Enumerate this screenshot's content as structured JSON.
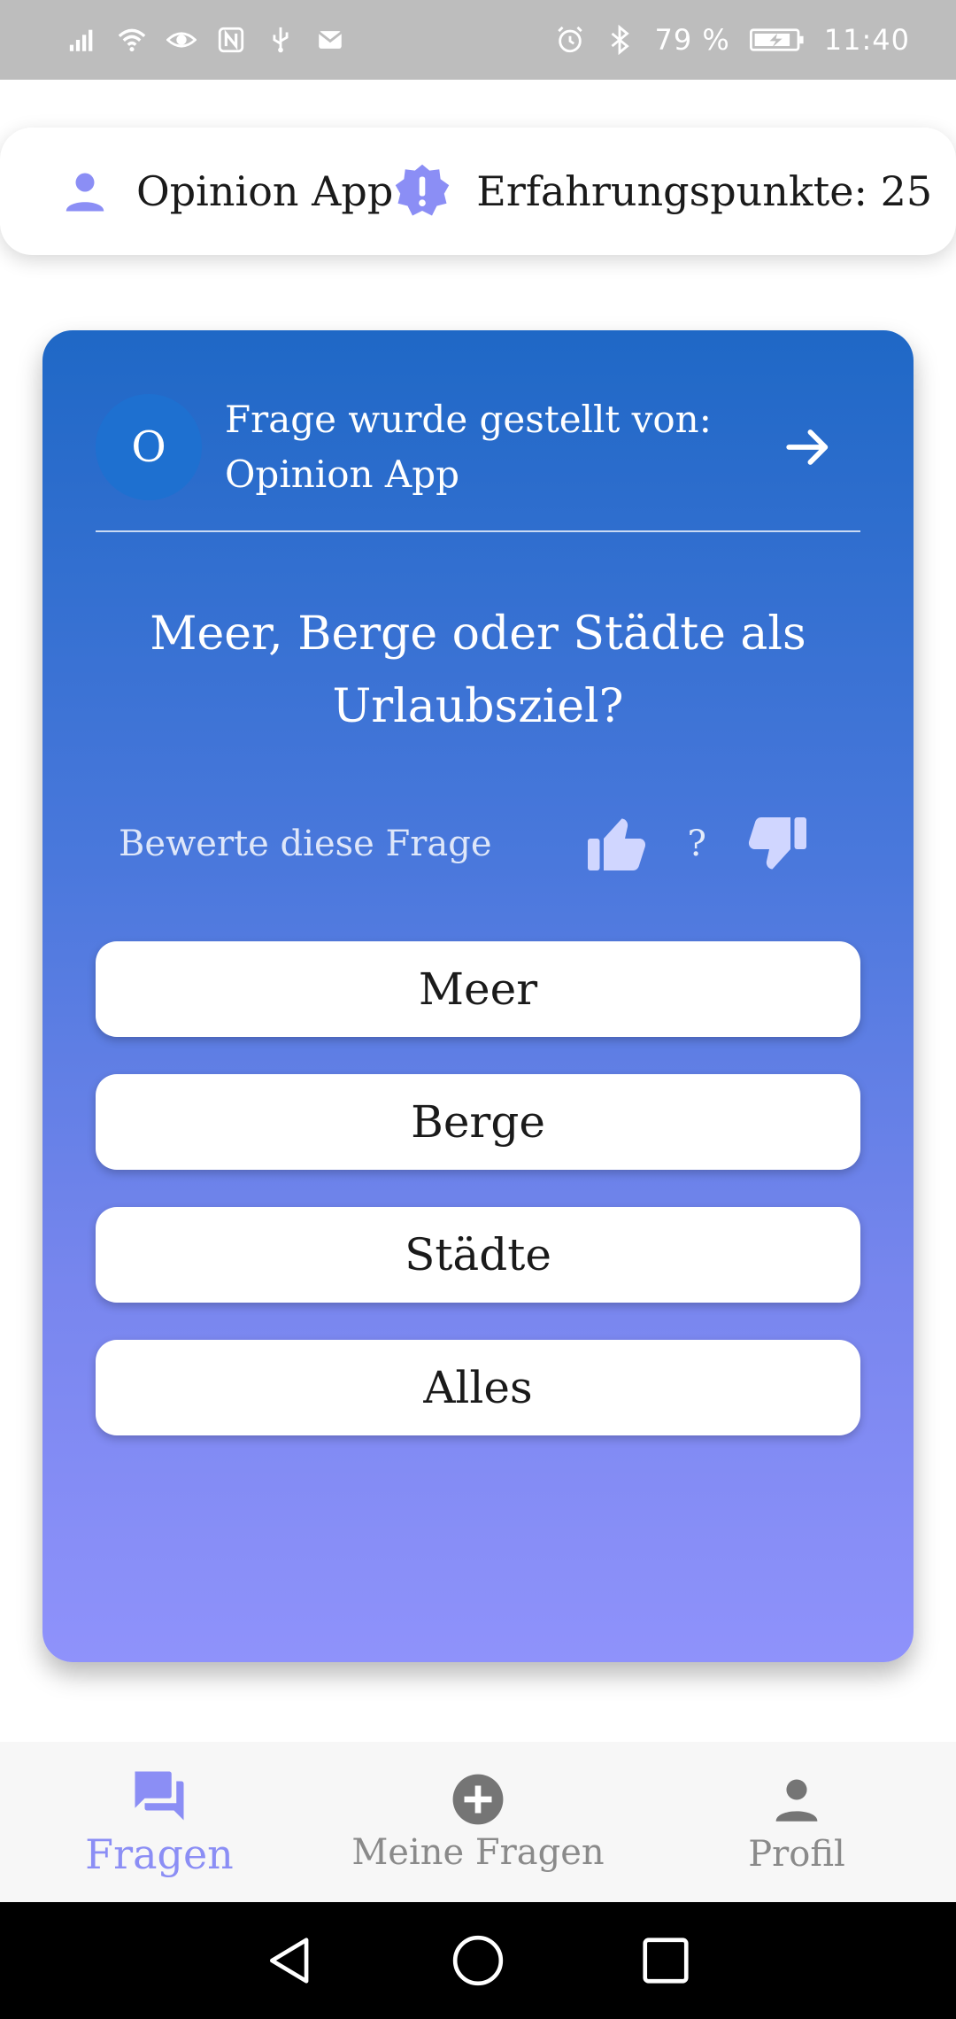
{
  "status_bar": {
    "battery_percent": "79 %",
    "time": "11:40"
  },
  "header": {
    "app_name": "Opinion App",
    "points_label": "Erfahrungspunkte: 25"
  },
  "question_card": {
    "avatar_letter": "O",
    "asked_by_label": "Frage wurde gestellt von:",
    "asked_by_name": "Opinion App",
    "question": "Meer, Berge oder Städte als Urlaubsziel?",
    "rate_label": "Bewerte diese Frage",
    "rating_value": "?",
    "answers": [
      "Meer",
      "Berge",
      "Städte",
      "Alles"
    ]
  },
  "bottom_nav": {
    "items": [
      {
        "label": "Fragen",
        "icon": "forum-icon",
        "active": true
      },
      {
        "label": "Meine Fragen",
        "icon": "add-circle-icon",
        "active": false
      },
      {
        "label": "Profil",
        "icon": "person-icon",
        "active": false
      }
    ]
  },
  "colors": {
    "accent": "#8b8ef5",
    "card_top": "#1f68c6",
    "card_bottom": "#8f92fb",
    "avatar_bg": "#1e70d0"
  }
}
